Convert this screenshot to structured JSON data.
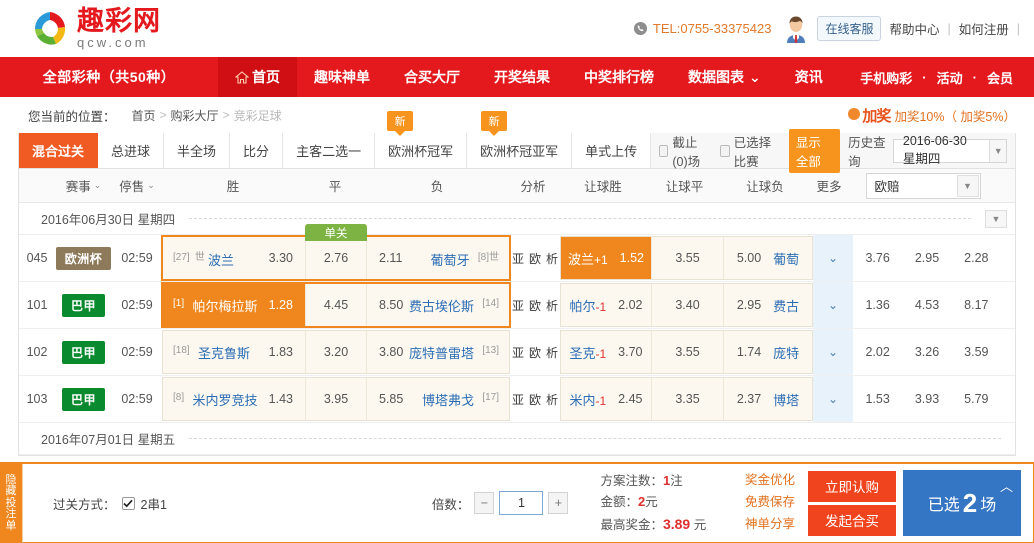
{
  "header": {
    "logo_cn": "趣彩网",
    "logo_en": "qcw.com",
    "tel": "TEL:0755-33375423",
    "kefu": "在线客服",
    "links": [
      "帮助中心",
      "如何注册"
    ],
    "sep": "|"
  },
  "nav": {
    "all_lottery": "全部彩种（共50种）",
    "items": [
      {
        "label": "首页",
        "icon": "home-icon",
        "active": true
      },
      {
        "label": "趣味神单",
        "active": false
      },
      {
        "label": "合买大厅",
        "active": false
      },
      {
        "label": "开奖结果",
        "active": false
      },
      {
        "label": "中奖排行榜",
        "active": false
      },
      {
        "label": "数据图表",
        "active": false,
        "caret": "⌄"
      },
      {
        "label": "资讯",
        "active": false
      }
    ],
    "right_items": [
      "手机购彩",
      "活动",
      "会员"
    ],
    "right_sep": "·"
  },
  "breadcrumb": {
    "label": "您当前的位置：",
    "items": [
      "首页",
      "购彩大厅",
      "竞彩足球"
    ],
    "arrow": ">"
  },
  "promo": {
    "badge": "加奖",
    "text": "加奖10%（ 加奖5%）"
  },
  "tabs": {
    "items": [
      {
        "label": "混合过关",
        "active": true,
        "new": false
      },
      {
        "label": "总进球",
        "active": false,
        "new": false
      },
      {
        "label": "半全场",
        "active": false,
        "new": false
      },
      {
        "label": "比分",
        "active": false,
        "new": false
      },
      {
        "label": "主客二选一",
        "active": false,
        "new": false
      },
      {
        "label": "欧洲杯冠军",
        "active": false,
        "new": true
      },
      {
        "label": "欧洲杯冠亚军",
        "active": false,
        "new": true
      },
      {
        "label": "单式上传",
        "active": false,
        "new": false
      }
    ],
    "new_badge": "新",
    "filters": [
      {
        "label": "截止(0)场",
        "checked": false
      },
      {
        "label": "已选择比赛",
        "checked": false
      }
    ],
    "show_all": "显示全部",
    "history_label": "历史查询",
    "history_date": "2016-06-30 星期四"
  },
  "table": {
    "headers": {
      "event": "赛事",
      "stop": "停售",
      "win": "胜",
      "draw": "平",
      "lose": "负",
      "analysis": "分析",
      "hwin": "让球胜",
      "hdraw": "让球平",
      "hlose": "让球负",
      "more": "更多",
      "odds_type": "欧赔"
    },
    "date_group": "2016年06月30日 星期四",
    "rows": [
      {
        "no": "045",
        "league": "欧洲杯",
        "league_color": "#8c7a5a",
        "time": "02:59",
        "home_rank": "[27]",
        "home_rank2": "世",
        "home": "波兰",
        "home_odd": "3.30",
        "draw_odd": "2.76",
        "away_odd": "2.11",
        "away": "葡萄牙",
        "away_rank": "[8]",
        "away_rank2": "世",
        "danguan": "单关",
        "highlight_main": true,
        "analysis": [
          "亚",
          "欧",
          "析"
        ],
        "h_team": "波兰",
        "h_hand": "+1",
        "h_win": "1.52",
        "h_draw": "3.55",
        "h_lose": "5.00",
        "h_away": "葡萄",
        "h_selected": true,
        "eu": [
          "3.76",
          "2.95",
          "2.28"
        ]
      },
      {
        "no": "101",
        "league": "巴甲",
        "league_color": "#0a8a2e",
        "time": "02:59",
        "home_rank": "[1]",
        "home_rank2": "",
        "home": "帕尔梅拉斯",
        "home_odd": "1.28",
        "draw_odd": "4.45",
        "away_odd": "8.50",
        "away": "费古埃伦斯",
        "away_rank": "[14]",
        "away_rank2": "",
        "danguan": "",
        "highlight_main": true,
        "main_selected": true,
        "analysis": [
          "亚",
          "欧",
          "析"
        ],
        "h_team": "帕尔",
        "h_hand": "-1",
        "h_win": "2.02",
        "h_draw": "3.40",
        "h_lose": "2.95",
        "h_away": "费古",
        "h_selected": false,
        "eu": [
          "1.36",
          "4.53",
          "8.17"
        ]
      },
      {
        "no": "102",
        "league": "巴甲",
        "league_color": "#0a8a2e",
        "time": "02:59",
        "home_rank": "[18]",
        "home_rank2": "",
        "home": "圣克鲁斯",
        "home_odd": "1.83",
        "draw_odd": "3.20",
        "away_odd": "3.80",
        "away": "庞特普雷塔",
        "away_rank": "[13]",
        "away_rank2": "",
        "danguan": "",
        "highlight_main": false,
        "analysis": [
          "亚",
          "欧",
          "析"
        ],
        "h_team": "圣克",
        "h_hand": "-1",
        "h_win": "3.70",
        "h_draw": "3.55",
        "h_lose": "1.74",
        "h_away": "庞特",
        "h_selected": false,
        "eu": [
          "2.02",
          "3.26",
          "3.59"
        ]
      },
      {
        "no": "103",
        "league": "巴甲",
        "league_color": "#0a8a2e",
        "time": "02:59",
        "home_rank": "[8]",
        "home_rank2": "",
        "home": "米内罗竞技",
        "home_odd": "1.43",
        "draw_odd": "3.95",
        "away_odd": "5.85",
        "away": "博塔弗戈",
        "away_rank": "[17]",
        "away_rank2": "",
        "danguan": "",
        "highlight_main": false,
        "analysis": [
          "亚",
          "欧",
          "析"
        ],
        "h_team": "米内",
        "h_hand": "-1",
        "h_win": "2.45",
        "h_draw": "3.35",
        "h_lose": "2.37",
        "h_away": "博塔",
        "h_selected": false,
        "eu": [
          "1.53",
          "3.93",
          "5.79"
        ]
      }
    ],
    "next_date_group": "2016年07月01日 星期五"
  },
  "slip": {
    "tab_label": "隐藏投注单",
    "pass_label": "过关方式：",
    "pass_value": "2串1",
    "multi_label": "倍数：",
    "multi_value": "1",
    "minus": "−",
    "plus": "+",
    "bets_label": "方案注数：",
    "bets_value": "1",
    "bets_unit": "注",
    "amount_label": "金额：",
    "amount_value": "2",
    "amount_unit": "元",
    "max_label": "最高奖金：",
    "max_value": "3.89",
    "max_unit": "元",
    "links": [
      "奖金优化",
      "免费保存",
      "神单分享"
    ],
    "buy_now": "立即认购",
    "group_buy": "发起合买",
    "chosen_pre": "已选",
    "chosen_num": "2",
    "chosen_post": "场"
  }
}
